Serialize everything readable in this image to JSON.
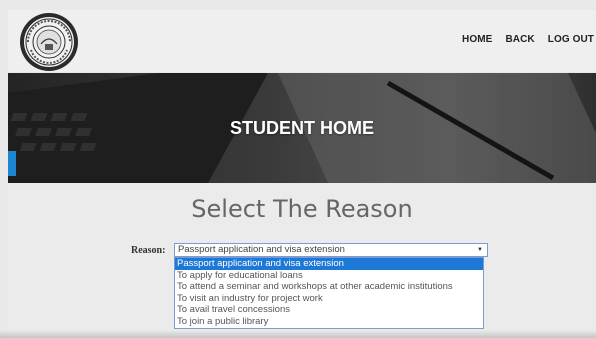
{
  "nav": {
    "items": [
      "HOME",
      "BACK",
      "LOG OUT"
    ]
  },
  "hero": {
    "title": "STUDENT HOME"
  },
  "form": {
    "title": "Select The Reason",
    "reason_label": "Reason:",
    "selected_value": "Passport application and visa extension",
    "options": [
      "Passport application and visa extension",
      "To apply for educational loans",
      "To attend a seminar and workshops at other academic institutions",
      "To visit an industry for project work",
      "To avail travel concessions",
      "To join a public library"
    ]
  },
  "colors": {
    "accent": "#1e78d6",
    "side_tab": "#1d86d0",
    "select_border": "#7a9cd3"
  }
}
